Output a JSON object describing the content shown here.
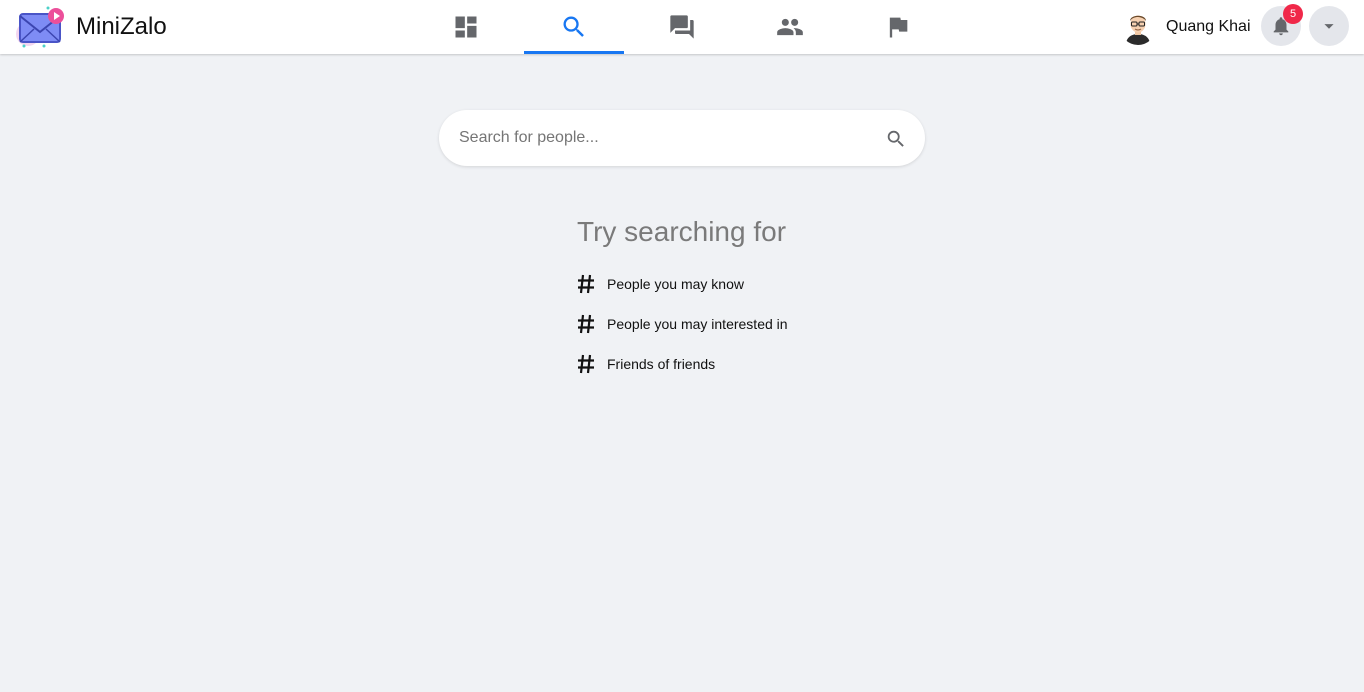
{
  "app": {
    "name": "MiniZalo"
  },
  "nav": {
    "tabs": [
      {
        "name": "dashboard",
        "icon": "dashboard-icon",
        "active": false
      },
      {
        "name": "search",
        "icon": "search-icon",
        "active": true
      },
      {
        "name": "messages",
        "icon": "chat-bubbles-icon",
        "active": false
      },
      {
        "name": "friends",
        "icon": "people-icon",
        "active": false
      },
      {
        "name": "pages",
        "icon": "flag-icon",
        "active": false
      }
    ]
  },
  "user": {
    "name": "Quang Khai",
    "avatar_icon": "avatar-icon",
    "notifications_count": "5"
  },
  "search": {
    "placeholder": "Search for people...",
    "value": ""
  },
  "suggestions": {
    "title": "Try searching for",
    "items": [
      {
        "label": "People you may know"
      },
      {
        "label": "People you may interested in"
      },
      {
        "label": "Friends of friends"
      }
    ]
  },
  "colors": {
    "accent": "#1877f2",
    "icon": "#65676b",
    "badge": "#f02849",
    "background": "#f0f2f5"
  }
}
